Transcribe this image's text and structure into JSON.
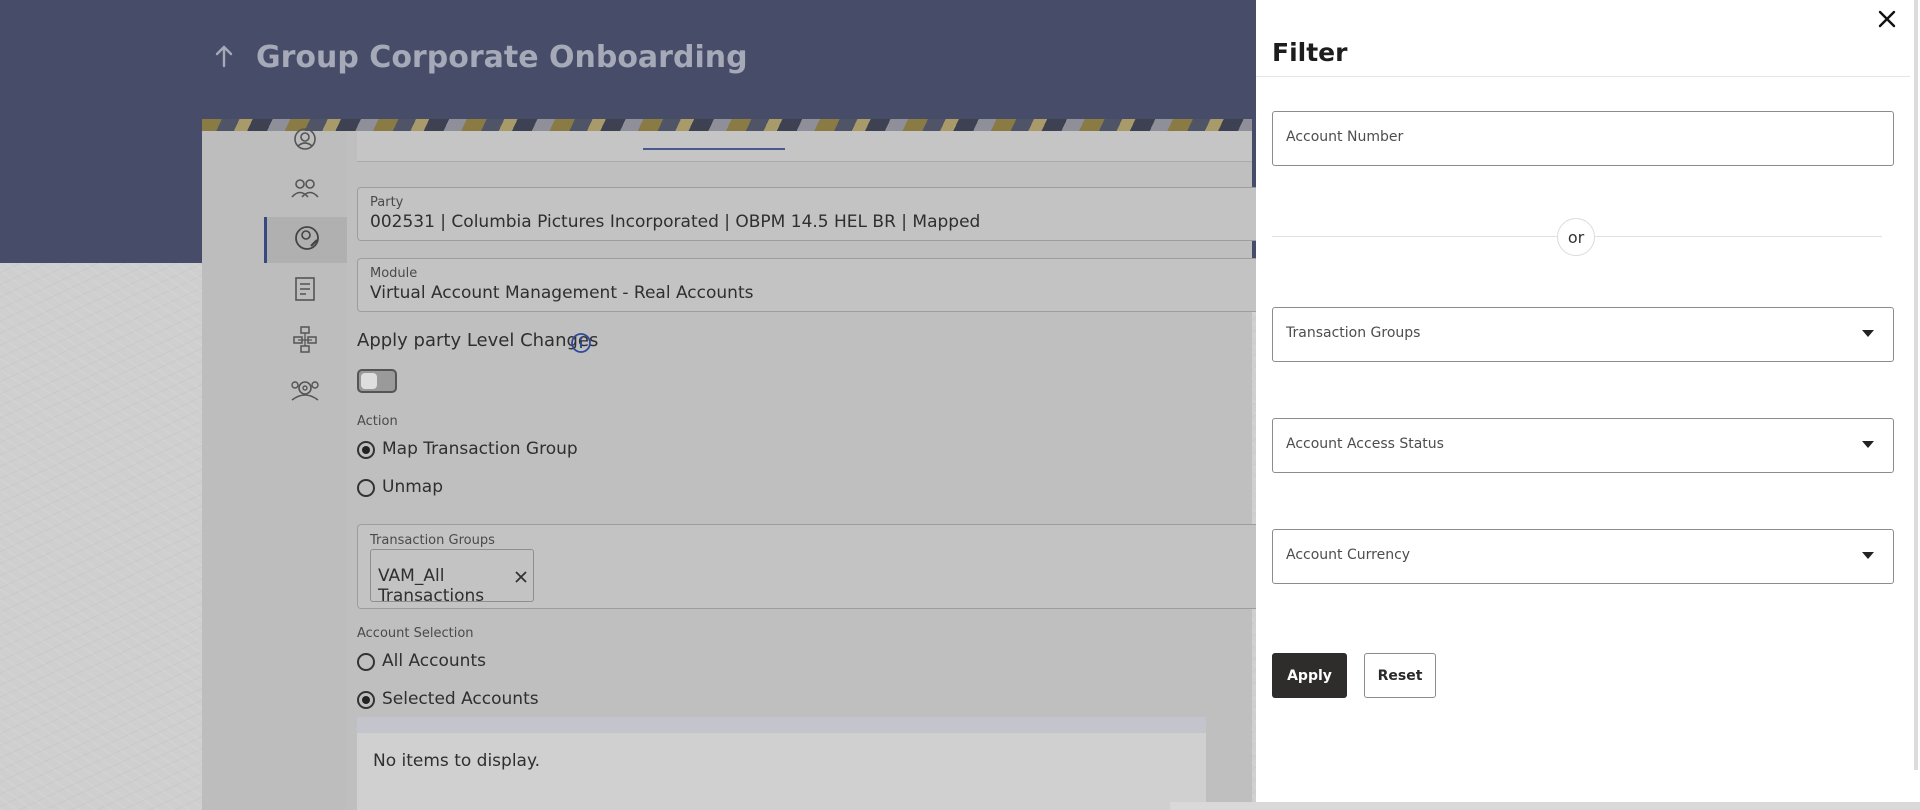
{
  "page": {
    "title": "Group Corporate Onboarding"
  },
  "form": {
    "party": {
      "label": "Party",
      "value": "002531 | Columbia Pictures Incorporated | OBPM 14.5 HEL BR | Mapped"
    },
    "module": {
      "label": "Module",
      "value": "Virtual Account Management - Real Accounts"
    },
    "apply_party_level": {
      "label": "Apply party Level Changes",
      "enabled": false
    },
    "action": {
      "label": "Action",
      "options": [
        {
          "label": "Map Transaction Group",
          "selected": true
        },
        {
          "label": "Unmap",
          "selected": false
        }
      ]
    },
    "transaction_groups": {
      "label": "Transaction Groups",
      "chips": [
        "VAM_All Transactions"
      ]
    },
    "account_selection": {
      "label": "Account Selection",
      "options": [
        {
          "label": "All Accounts",
          "selected": false
        },
        {
          "label": "Selected Accounts",
          "selected": true
        }
      ]
    },
    "table": {
      "empty_text": "No items to display."
    }
  },
  "filter": {
    "title": "Filter",
    "account_number_label": "Account Number",
    "or_text": "or",
    "transaction_groups_label": "Transaction Groups",
    "account_access_status_label": "Account Access Status",
    "account_currency_label": "Account Currency",
    "apply_label": "Apply",
    "reset_label": "Reset"
  },
  "icons": {
    "back": "arrow-up-icon",
    "close": "close-icon",
    "info": "info-icon",
    "nav": [
      "user-circle-icon",
      "users-icon",
      "user-edit-icon",
      "document-grid-icon",
      "workflow-icon",
      "group-gear-icon"
    ],
    "chip_remove": "close-icon",
    "dropdown": "chevron-down-icon"
  },
  "colors": {
    "header": "#474d69",
    "apply_button": "#2f2c2c",
    "nav_active": "#3a4880"
  }
}
